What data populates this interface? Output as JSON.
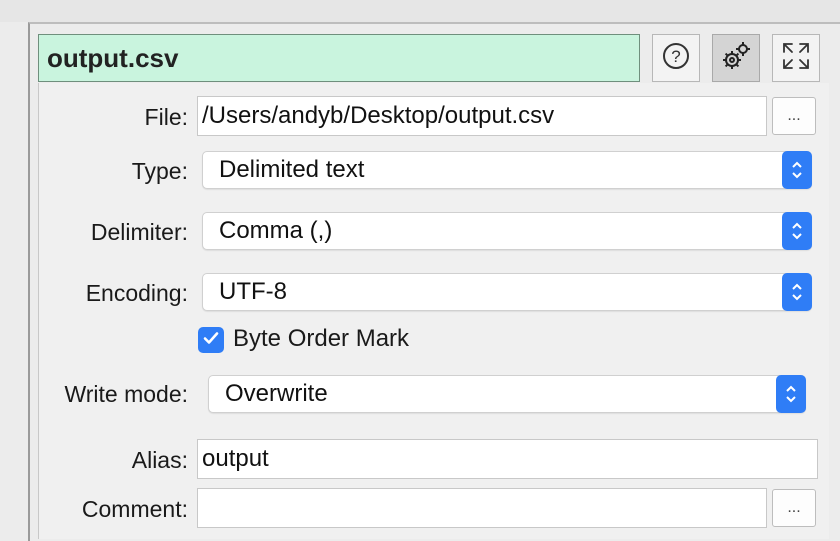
{
  "header": {
    "title": "output.csv",
    "help_icon": "question-circle-icon",
    "settings_icon": "gears-icon",
    "expand_icon": "expand-arrows-icon"
  },
  "form": {
    "file": {
      "label": "File:",
      "value": "/Users/andyb/Desktop/output.csv",
      "browse_label": "..."
    },
    "type": {
      "label": "Type:",
      "value": "Delimited text"
    },
    "delimiter": {
      "label": "Delimiter:",
      "value": "Comma (,)"
    },
    "encoding": {
      "label": "Encoding:",
      "value": "UTF-8"
    },
    "bom": {
      "label": "Byte Order Mark",
      "checked": true
    },
    "write_mode": {
      "label": "Write mode:",
      "value": "Overwrite"
    },
    "alias": {
      "label": "Alias:",
      "value": "output"
    },
    "comment": {
      "label": "Comment:",
      "value": "",
      "browse_label": "..."
    }
  },
  "colors": {
    "title_bg": "#c9f4de",
    "accent": "#2f7df6"
  }
}
